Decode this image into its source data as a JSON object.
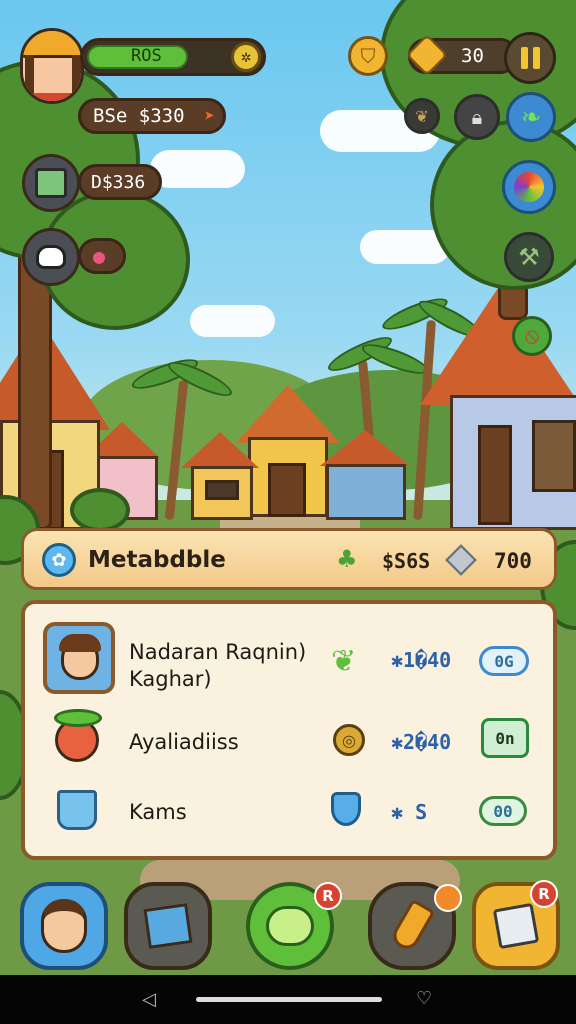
{
  "hud": {
    "level_label": "ROS",
    "level_progress": 0.72,
    "coins_label": "BSe $330",
    "cash_label": "D$336",
    "counter_value": "30",
    "pause_icon": "pause-icon"
  },
  "shop": {
    "title": "Metabdble",
    "price": "$S6S",
    "gems": "700",
    "items": [
      {
        "name_line1": "Nadaran Raqnin)",
        "name_line2": "Kaghar)",
        "value": "✱1�40",
        "badge": "0G"
      },
      {
        "name_line1": "Ayaliadiiss",
        "name_line2": "",
        "value": "✱2�40",
        "badge": "0n"
      },
      {
        "name_line1": "Kams",
        "name_line2": "",
        "value": "✱ S",
        "badge": "00"
      }
    ]
  },
  "dock": {
    "badge_chat": "R",
    "badge_shop": "R"
  },
  "colors": {
    "accent_green": "#5fbf3a",
    "panel_bg": "#fbf1df",
    "value_blue": "#2d62a8"
  }
}
